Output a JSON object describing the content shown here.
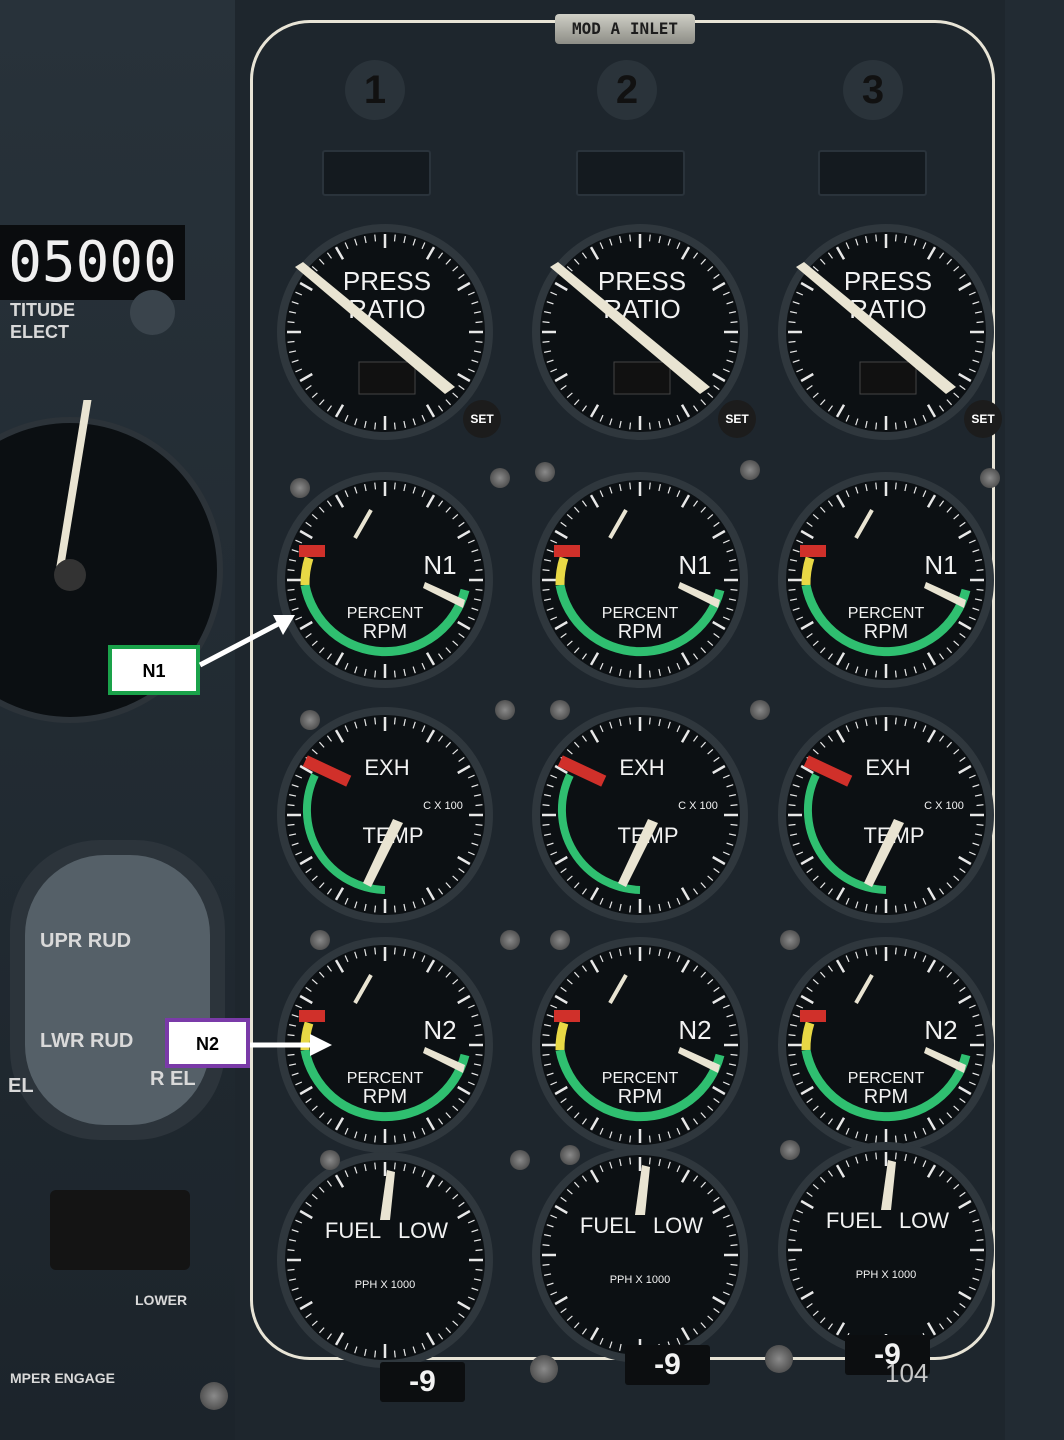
{
  "panel": {
    "placard": "MOD A INLET",
    "engines": [
      "1",
      "2",
      "3"
    ],
    "bottom_labels": [
      "-9",
      "-9",
      "-9"
    ],
    "page_number": "104"
  },
  "left_panel": {
    "altitude_digits": "05000",
    "altitude_caption_1": "TITUDE",
    "altitude_caption_2": "ELECT",
    "rud_upper": "UPR RUD",
    "rud_lower": "LWR RUD",
    "rud_right": "R EL",
    "rud_left": "EL",
    "lower_label": "LOWER",
    "engage_label": "MPER ENGAGE"
  },
  "gauges": {
    "press_ratio": {
      "title_1": "PRESS",
      "title_2": "RATIO",
      "set_label": "SET"
    },
    "n1": {
      "title": "N1",
      "caption_1": "PERCENT",
      "caption_2": "RPM"
    },
    "egt": {
      "title_1": "EXH",
      "title_2": "TEMP",
      "scale": "C X 100"
    },
    "n2": {
      "title": "N2",
      "caption_1": "PERCENT",
      "caption_2": "RPM"
    },
    "fuel": {
      "title_1": "FUEL",
      "title_2": "LOW",
      "scale": "PPH X 1000"
    }
  },
  "callouts": {
    "n1": {
      "label": "N1",
      "color": "#1aa24a"
    },
    "n2": {
      "label": "N2",
      "color": "#7a3aa8"
    }
  }
}
